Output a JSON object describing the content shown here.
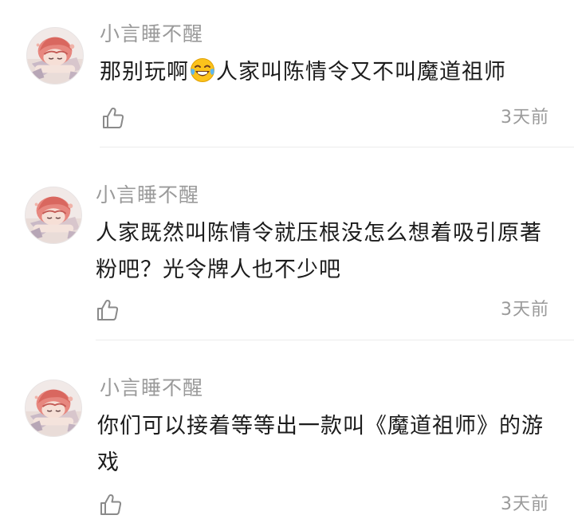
{
  "comments": [
    {
      "username": "小言睡不醒",
      "text_before_emoji": "那别玩啊",
      "emoji": "face-with-tears-of-joy-emoji",
      "text_after_emoji": "人家叫陈情令又不叫魔道祖师",
      "timestamp": "3天前",
      "like_icon": "thumbs-up-icon"
    },
    {
      "username": "小言睡不醒",
      "text": "人家既然叫陈情令就压根没怎么想着吸引原著粉吧？光令牌人也不少吧",
      "timestamp": "3天前",
      "like_icon": "thumbs-up-icon"
    },
    {
      "username": "小言睡不醒",
      "text": "你们可以接着等等出一款叫《魔道祖师》的游戏",
      "timestamp": "3天前",
      "like_icon": "thumbs-up-icon"
    }
  ],
  "colors": {
    "username": "#9a9a9a",
    "content": "#1c1c1c",
    "timestamp": "#9a9a9a",
    "divider": "#ececec",
    "icon_stroke": "#8a8a8a"
  }
}
